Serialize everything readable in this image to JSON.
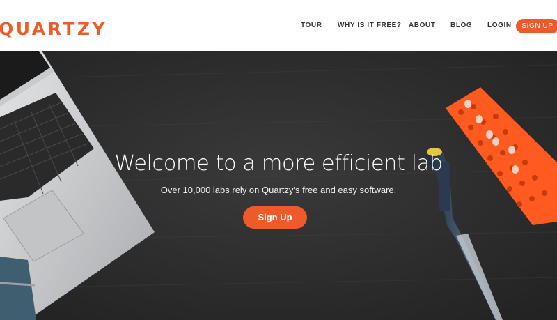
{
  "brand": {
    "logo_text": "QUARTZY",
    "accent_color": "#ef5a2a"
  },
  "nav": {
    "tour": "TOUR",
    "why_free": "WHY IS IT FREE?",
    "about": "ABOUT",
    "blog": "BLOG",
    "login": "LOGIN",
    "signup": "SIGN UP"
  },
  "hero": {
    "title": "Welcome to a more efficient lab",
    "subtitle": "Over 10,000 labs rely on Quartzy's free and easy software.",
    "cta": "Sign Up",
    "background_description": "Dark wooden desk with a laptop, a notebook, a pipette and an orange tube rack"
  }
}
